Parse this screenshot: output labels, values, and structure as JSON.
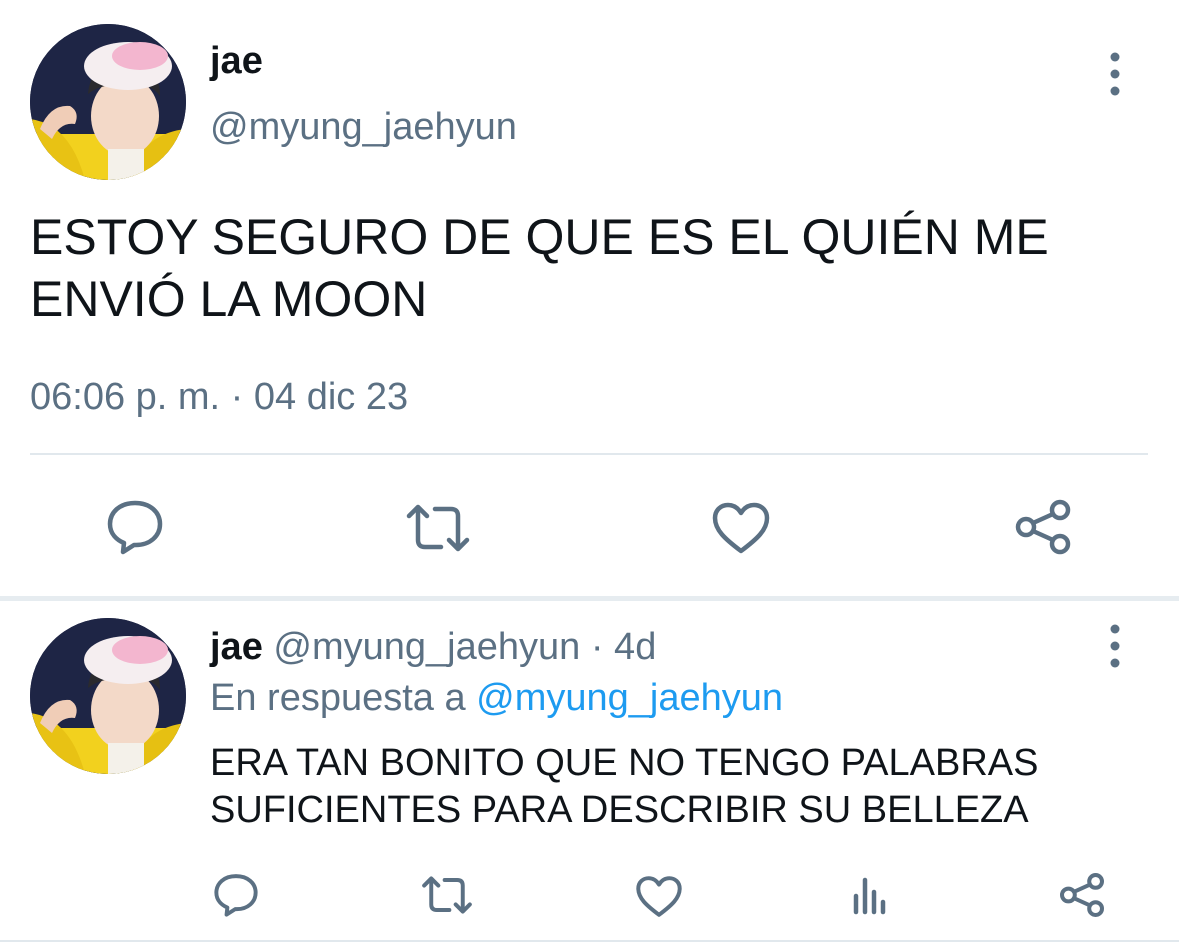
{
  "main_tweet": {
    "display_name": "jae",
    "handle": "@myung_jaehyun",
    "text_line1": "ESTOY SEGURO DE QUE ES EL QUIÉN ME",
    "text_line2": "ENVIÓ LA MOON",
    "timestamp": "06:06 p. m. · 04 dic 23",
    "actions": [
      "reply-icon",
      "retweet-icon",
      "like-icon",
      "share-icon"
    ]
  },
  "reply_tweet": {
    "display_name": "jae",
    "handle": "@myung_jaehyun",
    "age": "· 4d",
    "in_reply_label": "En respuesta a",
    "in_reply_handle": "@myung_jaehyun",
    "text_line1": "ERA TAN BONITO QUE NO TENGO PALABRAS",
    "text_line2": "SUFICIENTES PARA DESCRIBIR SU BELLEZA",
    "actions": [
      "reply-icon",
      "retweet-icon",
      "like-icon",
      "analytics-icon",
      "share-icon"
    ]
  },
  "colors": {
    "text": "#0f1419",
    "secondary": "#5b7083",
    "link": "#1d9bf0",
    "divider": "#e1e8ed"
  }
}
